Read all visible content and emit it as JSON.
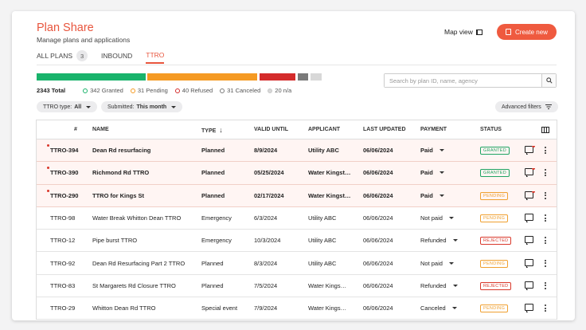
{
  "header": {
    "title": "Plan Share",
    "subtitle": "Manage plans and applications",
    "map_view": "Map view",
    "create_new": "Create new"
  },
  "tabs": [
    {
      "label": "ALL PLANS",
      "count": "3"
    },
    {
      "label": "INBOUND"
    },
    {
      "label": "TTRO"
    }
  ],
  "summary": {
    "total": "2343 Total",
    "granted": "342 Granted",
    "pending": "31 Pending",
    "refused": "40 Refused",
    "canceled": "31 Canceled",
    "na": "20 n/a",
    "colors": {
      "granted": "#19b36b",
      "pending": "#f59a23",
      "refused": "#d42b2b",
      "canceled": "#7a7a7a",
      "na": "#d8d8d8"
    }
  },
  "search": {
    "placeholder": "Search by plan ID, name, agency"
  },
  "filters": {
    "ttro_type_label": "TTRO type:",
    "ttro_type_value": "All",
    "submitted_label": "Submitted:",
    "submitted_value": "This month",
    "advanced": "Advanced filters"
  },
  "table": {
    "columns": {
      "num": "#",
      "name": "NAME",
      "type": "TYPE",
      "valid": "VALID UNTIL",
      "applicant": "APPLICANT",
      "updated": "LAST UPDATED",
      "payment": "PAYMENT",
      "status": "STATUS"
    },
    "rows": [
      {
        "id": "TTRO-394",
        "name": "Dean Rd resurfacing",
        "type": "Planned",
        "valid": "8/9/2024",
        "applicant": "Utility ABC",
        "updated": "06/06/2024",
        "payment": "Paid",
        "status": "GRANTED"
      },
      {
        "id": "TTRO-390",
        "name": "Richmond Rd TTRO",
        "type": "Planned",
        "valid": "05/25/2024",
        "applicant": "Water Kingst…",
        "updated": "06/06/2024",
        "payment": "Paid",
        "status": "GRANTED"
      },
      {
        "id": "TTRO-290",
        "name": "TTRO for Kings St",
        "type": "Planned",
        "valid": "02/17/2024",
        "applicant": "Water Kingst…",
        "updated": "06/06/2024",
        "payment": "Paid",
        "status": "PENDING"
      },
      {
        "id": "TTRO-98",
        "name": "Water Break Whitton Dean TTRO",
        "type": "Emergency",
        "valid": "6/3/2024",
        "applicant": "Utility ABC",
        "updated": "06/06/2024",
        "payment": "Not paid",
        "status": "PENDING"
      },
      {
        "id": "TTRO-12",
        "name": "Pipe burst TTRO",
        "type": "Emergency",
        "valid": "10/3/2024",
        "applicant": "Utility ABC",
        "updated": "06/06/2024",
        "payment": "Refunded",
        "status": "REJECTED"
      },
      {
        "id": "TTRO-92",
        "name": "Dean Rd Resurfacing Part 2 TTRO",
        "type": "Planned",
        "valid": "8/3/2024",
        "applicant": "Utility ABC",
        "updated": "06/06/2024",
        "payment": "Not paid",
        "status": "PENDING"
      },
      {
        "id": "TTRO-83",
        "name": "St Margarets Rd Closure TTRO",
        "type": "Planned",
        "valid": "7/5/2024",
        "applicant": "Water Kings…",
        "updated": "06/06/2024",
        "payment": "Refunded",
        "status": "REJECTED"
      },
      {
        "id": "TTRO-29",
        "name": "Whitton Dean Rd TTRO",
        "type": "Special event",
        "valid": "7/9/2024",
        "applicant": "Water Kings…",
        "updated": "06/06/2024",
        "payment": "Canceled",
        "status": "PENDING"
      }
    ],
    "status_colors": {
      "GRANTED": "#1fa463",
      "PENDING": "#f0a030",
      "REJECTED": "#d9382b"
    }
  },
  "accent": "#ef5a3f"
}
